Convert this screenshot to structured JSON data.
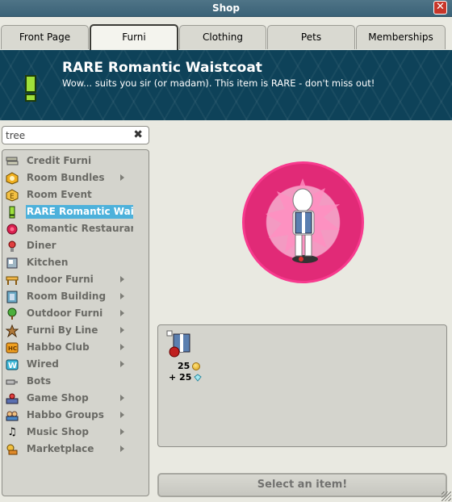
{
  "window": {
    "title": "Shop",
    "close_label": "✕"
  },
  "tabs": [
    {
      "label": "Front Page",
      "active": false
    },
    {
      "label": "Furni",
      "active": true
    },
    {
      "label": "Clothing",
      "active": false
    },
    {
      "label": "Pets",
      "active": false
    },
    {
      "label": "Memberships",
      "active": false
    }
  ],
  "banner": {
    "title": "RARE Romantic Waistcoat",
    "description": "Wow... suits you sir (or madam). This item is RARE - don't miss out!"
  },
  "search": {
    "value": "tree",
    "clear_label": "✖"
  },
  "categories": [
    {
      "label": "Credit Furni",
      "icon": "credit-furni-icon",
      "arrow": false,
      "selected": false
    },
    {
      "label": "Room Bundles",
      "icon": "room-bundles-icon",
      "arrow": true,
      "selected": false
    },
    {
      "label": "Room Event",
      "icon": "room-event-icon",
      "arrow": false,
      "selected": false
    },
    {
      "label": "RARE Romantic Waistcoat",
      "icon": "exclamation-icon",
      "arrow": false,
      "selected": true
    },
    {
      "label": "Romantic Restaurant furni",
      "icon": "rose-icon",
      "arrow": false,
      "selected": false
    },
    {
      "label": "Diner",
      "icon": "diner-icon",
      "arrow": false,
      "selected": false
    },
    {
      "label": "Kitchen",
      "icon": "kitchen-icon",
      "arrow": false,
      "selected": false
    },
    {
      "label": "Indoor Furni",
      "icon": "indoor-furni-icon",
      "arrow": true,
      "selected": false
    },
    {
      "label": "Room Building",
      "icon": "room-building-icon",
      "arrow": true,
      "selected": false
    },
    {
      "label": "Outdoor Furni",
      "icon": "outdoor-furni-icon",
      "arrow": true,
      "selected": false
    },
    {
      "label": "Furni By Line",
      "icon": "star-icon",
      "arrow": true,
      "selected": false
    },
    {
      "label": "Habbo Club",
      "icon": "habbo-club-icon",
      "arrow": true,
      "selected": false
    },
    {
      "label": "Wired",
      "icon": "wired-icon",
      "arrow": true,
      "selected": false
    },
    {
      "label": "Bots",
      "icon": "bots-icon",
      "arrow": false,
      "selected": false
    },
    {
      "label": "Game Shop",
      "icon": "game-shop-icon",
      "arrow": true,
      "selected": false
    },
    {
      "label": "Habbo Groups",
      "icon": "habbo-groups-icon",
      "arrow": true,
      "selected": false
    },
    {
      "label": "Music Shop",
      "icon": "music-note-icon",
      "arrow": true,
      "selected": false
    },
    {
      "label": "Marketplace",
      "icon": "marketplace-icon",
      "arrow": true,
      "selected": false
    }
  ],
  "offer": {
    "price_credits": "25",
    "price_diamonds": "+ 25"
  },
  "action_button": {
    "label": "Select an item!"
  },
  "colors": {
    "banner_bg": "#0e4259",
    "selected_item": "#4db1db",
    "preview_ring": "#e12a77",
    "close_button": "#c7362a"
  }
}
